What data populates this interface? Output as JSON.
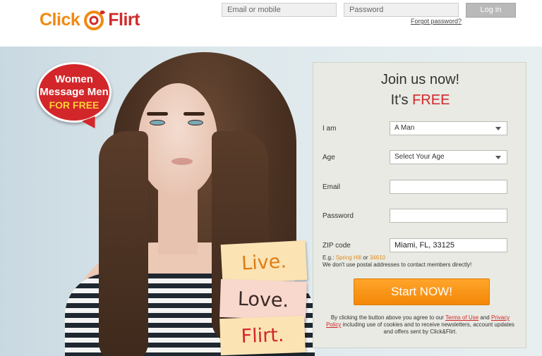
{
  "header": {
    "logo_left": "Click",
    "logo_right": "Flirt",
    "email_placeholder": "Email or mobile",
    "password_placeholder": "Password",
    "login_label": "Log in",
    "forgot_label": "Forgot password?"
  },
  "badge": {
    "line1": "Women",
    "line2": "Message Men",
    "line3": "FOR FREE"
  },
  "notes": [
    "Live.",
    "Love.",
    "Flirt."
  ],
  "signup": {
    "title_line1": "Join us now!",
    "title_line2_prefix": "It's ",
    "title_line2_free": "FREE",
    "fields": [
      {
        "label": "I am",
        "value": "A Man"
      },
      {
        "label": "Age",
        "value": "Select Your Age"
      },
      {
        "label": "Email",
        "value": ""
      },
      {
        "label": "Password",
        "value": ""
      },
      {
        "label": "ZIP code",
        "value": "Miami, FL, 33125"
      }
    ],
    "example_prefix": "E.g.: ",
    "example_city": "Spring Hill",
    "example_or": " or ",
    "example_zip": "34610",
    "postal_note": "We don't use postal addresses to contact members directly!",
    "start_label": "Start NOW!",
    "terms_prefix": "By clicking the button above you agree to our ",
    "terms_link": "Terms of Use",
    "terms_and": " and ",
    "privacy_link": "Privacy Policy",
    "terms_rest": " including use of cookies and to receive newsletters, account updates and offers sent by Click&Flirt."
  },
  "colors": {
    "brand_orange": "#f08a12",
    "brand_red": "#d3262a",
    "panel_bg": "#e8eae3",
    "button_orange": "#f38708"
  }
}
